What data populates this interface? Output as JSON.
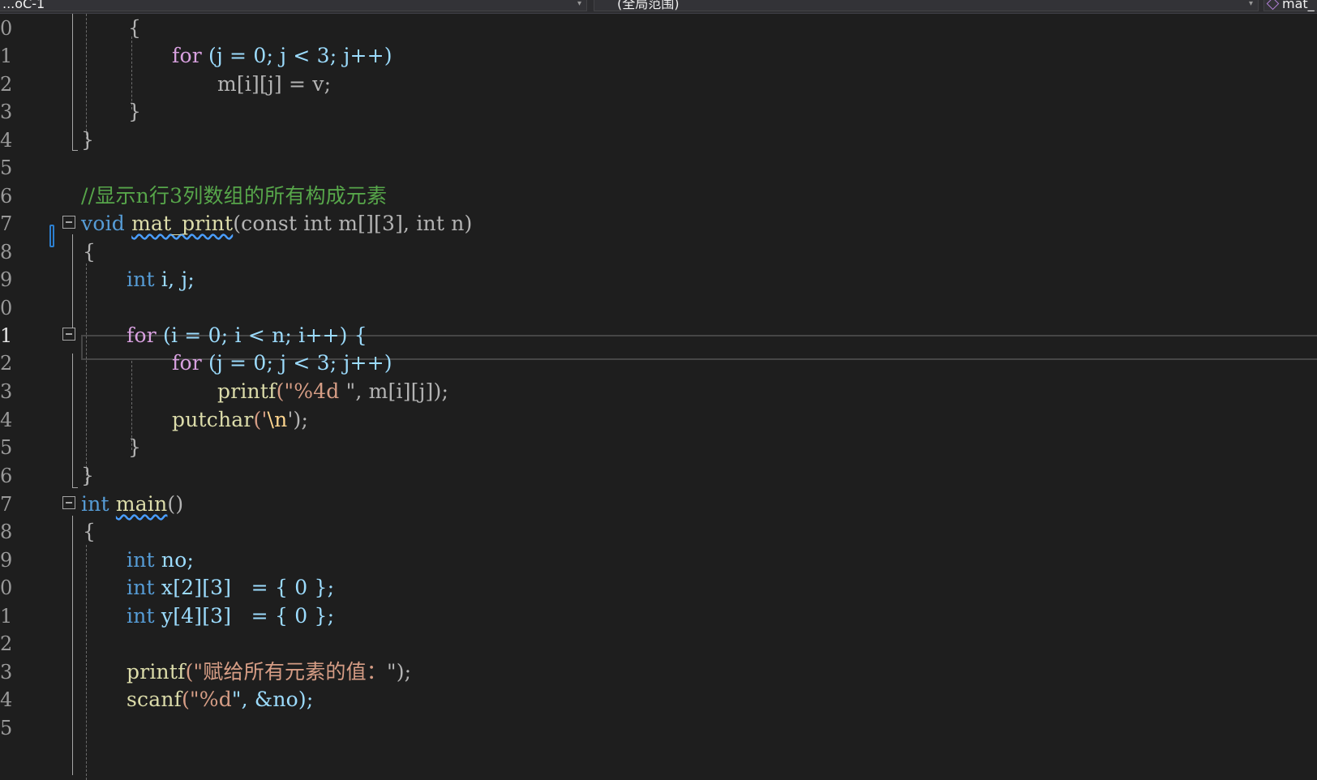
{
  "navigation_bar": {
    "project": "...oC-1",
    "scope": "(全局范围)",
    "member": "mat_"
  },
  "editor": {
    "lines": [
      {
        "number": "0"
      },
      {
        "number": "1"
      },
      {
        "number": "2"
      },
      {
        "number": "3"
      },
      {
        "number": "4"
      },
      {
        "number": "5"
      },
      {
        "number": "6"
      },
      {
        "number": "7"
      },
      {
        "number": "8"
      },
      {
        "number": "9"
      },
      {
        "number": "0"
      },
      {
        "number": "1",
        "current": true
      },
      {
        "number": "2"
      },
      {
        "number": "3"
      },
      {
        "number": "4"
      },
      {
        "number": "5"
      },
      {
        "number": "6"
      },
      {
        "number": "7"
      },
      {
        "number": "8"
      },
      {
        "number": "9"
      },
      {
        "number": "0"
      },
      {
        "number": "1"
      },
      {
        "number": "2"
      },
      {
        "number": "3"
      },
      {
        "number": "4"
      },
      {
        "number": "5"
      }
    ],
    "tokens": {
      "for": "for",
      "void": "void",
      "const": "const",
      "int": "int",
      "open_brace": "{",
      "close_brace": "}",
      "l1_loop": " (j = 0; j < 3; j++)",
      "l2_stmt": "m[i][j] = v;",
      "comment": "//显示n行3列数组的所有构成元素",
      "fn_name": "mat_print",
      "fn_params": "(const int m[][3], int n)",
      "l9_decl": " i, j;",
      "l11_loop": " (i = 0; i < n; i++) {",
      "l12_loop": " (j = 0; j < 3; j++)",
      "printf": "printf",
      "l13_args_open": "(\"",
      "l13_fmt": "%4d ",
      "l13_args_close": "\", m[i][j]);",
      "putchar": "putchar",
      "l14_open": "('",
      "l14_esc": "\\n",
      "l14_close": "');",
      "main": "main",
      "main_parens": "()",
      "l19_decl": " no;",
      "l20_decl": " x[2][3]   = { 0 };",
      "l21_decl": " y[4][3]   = { 0 };",
      "l23_open": "(\"",
      "l23_str": "赋给所有元素的值：",
      "l23_close": "\");",
      "scanf": "scanf",
      "l24_open": "(\"",
      "l24_fmt": "%d",
      "l24_close": "\", &no);"
    }
  }
}
